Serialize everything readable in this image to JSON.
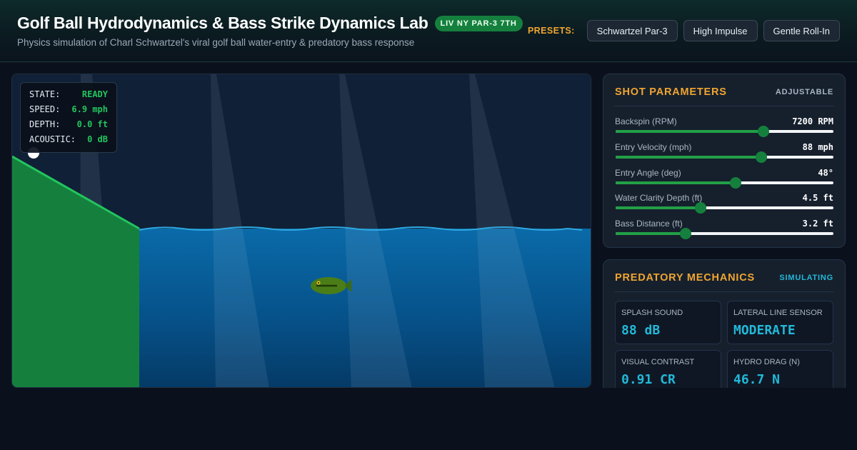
{
  "header": {
    "title": "Golf Ball Hydrodynamics & Bass Strike Dynamics Lab",
    "badge": "LIV NY PAR-3 7TH",
    "subtitle": "Physics simulation of Charl Schwartzel's viral golf ball water-entry & predatory bass response",
    "presets_label": "PRESETS:",
    "presets": [
      "Schwartzel Par-3",
      "High Impulse",
      "Gentle Roll-In"
    ]
  },
  "hud": {
    "rows": [
      {
        "key": "STATE:",
        "value": "READY"
      },
      {
        "key": "SPEED:",
        "value": "6.9 mph"
      },
      {
        "key": "DEPTH:",
        "value": "0.0 ft"
      },
      {
        "key": "ACOUSTIC:",
        "value": "0 dB"
      }
    ]
  },
  "shot": {
    "title": "SHOT PARAMETERS",
    "tag": "ADJUSTABLE",
    "params": [
      {
        "label": "Backspin (RPM)",
        "value": "7200 RPM",
        "level": 0.68
      },
      {
        "label": "Entry Velocity (mph)",
        "value": "88 mph",
        "level": 0.67
      },
      {
        "label": "Entry Angle (deg)",
        "value": "48°",
        "level": 0.55
      },
      {
        "label": "Water Clarity Depth (ft)",
        "value": "4.5 ft",
        "level": 0.39
      },
      {
        "label": "Bass Distance (ft)",
        "value": "3.2 ft",
        "level": 0.32
      }
    ]
  },
  "mechanics": {
    "title": "PREDATORY MECHANICS",
    "tag": "SIMULATING",
    "metrics": [
      {
        "label": "SPLASH SOUND",
        "value": "88 dB"
      },
      {
        "label": "LATERAL LINE SENSOR",
        "value": "MODERATE"
      },
      {
        "label": "VISUAL CONTRAST",
        "value": "0.91 CR"
      },
      {
        "label": "HYDRO DRAG (N)",
        "value": "46.7 N"
      }
    ]
  },
  "colors": {
    "accent": "#f0a530",
    "success": "#22c55e",
    "info": "#22b8d8",
    "water": "#0a6aa8",
    "bank": "#15803d"
  }
}
